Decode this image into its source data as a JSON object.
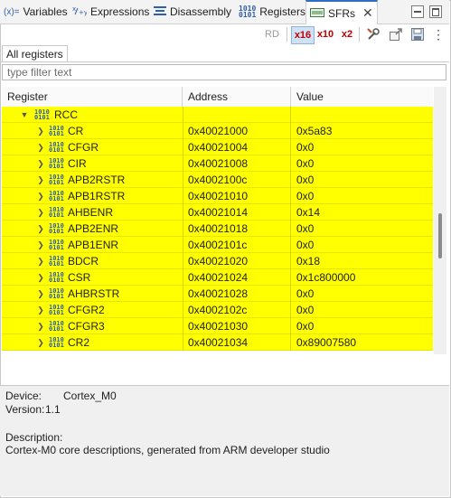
{
  "tabs": [
    {
      "icon": "variables-icon",
      "prefix": "(x)=",
      "label": "Variables"
    },
    {
      "icon": "expressions-icon",
      "label": "Expressions"
    },
    {
      "icon": "disassembly-icon",
      "label": "Disassembly"
    },
    {
      "icon": "registers-icon",
      "label": "Registers"
    },
    {
      "icon": "sfrs-icon",
      "label": "SFRs",
      "active": true,
      "close": "✕"
    }
  ],
  "toolbar": {
    "read_label": "RD",
    "hex_label": "x16",
    "dec_label": "x10",
    "bin_label": "x2",
    "view_menu": "⋮"
  },
  "subtab": {
    "label": "All registers"
  },
  "filter": {
    "placeholder": "type filter text",
    "value": ""
  },
  "table": {
    "columns": [
      "Register",
      "Address",
      "Value"
    ],
    "group": {
      "name": "RCC",
      "expanded": true
    },
    "rows": [
      {
        "name": "CR",
        "address": "0x40021000",
        "value": "0x5a83"
      },
      {
        "name": "CFGR",
        "address": "0x40021004",
        "value": "0x0"
      },
      {
        "name": "CIR",
        "address": "0x40021008",
        "value": "0x0"
      },
      {
        "name": "APB2RSTR",
        "address": "0x4002100c",
        "value": "0x0"
      },
      {
        "name": "APB1RSTR",
        "address": "0x40021010",
        "value": "0x0"
      },
      {
        "name": "AHBENR",
        "address": "0x40021014",
        "value": "0x14"
      },
      {
        "name": "APB2ENR",
        "address": "0x40021018",
        "value": "0x0"
      },
      {
        "name": "APB1ENR",
        "address": "0x4002101c",
        "value": "0x0"
      },
      {
        "name": "BDCR",
        "address": "0x40021020",
        "value": "0x18"
      },
      {
        "name": "CSR",
        "address": "0x40021024",
        "value": "0x1c800000"
      },
      {
        "name": "AHBRSTR",
        "address": "0x40021028",
        "value": "0x0"
      },
      {
        "name": "CFGR2",
        "address": "0x4002102c",
        "value": "0x0"
      },
      {
        "name": "CFGR3",
        "address": "0x40021030",
        "value": "0x0"
      },
      {
        "name": "CR2",
        "address": "0x40021034",
        "value": "0x89007580"
      }
    ],
    "row_highlight": "#ffff00"
  },
  "details": {
    "device_label": "Device:",
    "device_value": "Cortex_M0",
    "version_label": "Version:",
    "version_value": "1.1",
    "description_label": "Description:",
    "description_value": "Cortex-M0 core descriptions, generated from ARM developer studio"
  }
}
